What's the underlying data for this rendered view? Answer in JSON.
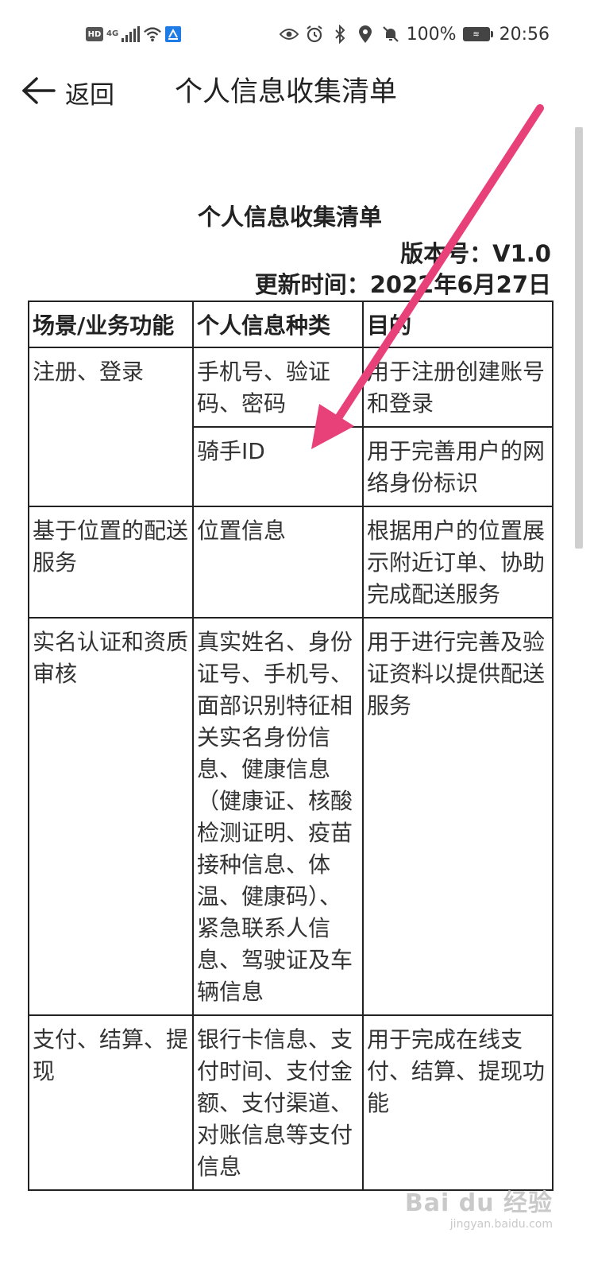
{
  "status_bar": {
    "hd": "HD",
    "network": "4G",
    "battery_percent": "100%",
    "time": "20:56",
    "icons": [
      "hd-icon",
      "signal-icon",
      "wifi-icon",
      "app-notification-icon",
      "eye-icon",
      "alarm-icon",
      "bluetooth-icon",
      "location-icon",
      "mute-icon",
      "battery-icon"
    ]
  },
  "nav": {
    "back_label": "返回",
    "title": "个人信息收集清单"
  },
  "document": {
    "title": "个人信息收集清单",
    "version": "版本号：V1.0",
    "updated": "更新时间：2022年6月27日",
    "headers": [
      "场景/业务功能",
      "个人信息种类",
      "目的"
    ],
    "rows": [
      {
        "scene": "注册、登录",
        "info": "手机号、验证码、密码",
        "purpose": "用于注册创建账号和登录"
      },
      {
        "info": "骑手ID",
        "purpose": "用于完善用户的网络身份标识"
      },
      {
        "scene": "基于位置的配送服务",
        "info": "位置信息",
        "purpose": "根据用户的位置展示附近订单、协助完成配送服务"
      },
      {
        "scene": "实名认证和资质审核",
        "info": "真实姓名、身份证号、手机号、面部识别特征相关实名身份信息、健康信息（健康证、核酸检测证明、疫苗接种信息、体温、健康码）、紧急联系人信息、驾驶证及车辆信息",
        "purpose": "用于进行完善及验证资料以提供配送服务"
      },
      {
        "scene": "支付、结算、提现",
        "info": "银行卡信息、支付时间、支付金额、支付渠道、对账信息等支付信息",
        "purpose": "用于完成在线支付、结算、提现功能"
      }
    ]
  },
  "watermark": {
    "main": "Bai du 经验",
    "sub": "jingyan.baidu.com"
  },
  "colors": {
    "arrow": "#e8417a",
    "text": "#222222",
    "border": "#222222"
  }
}
